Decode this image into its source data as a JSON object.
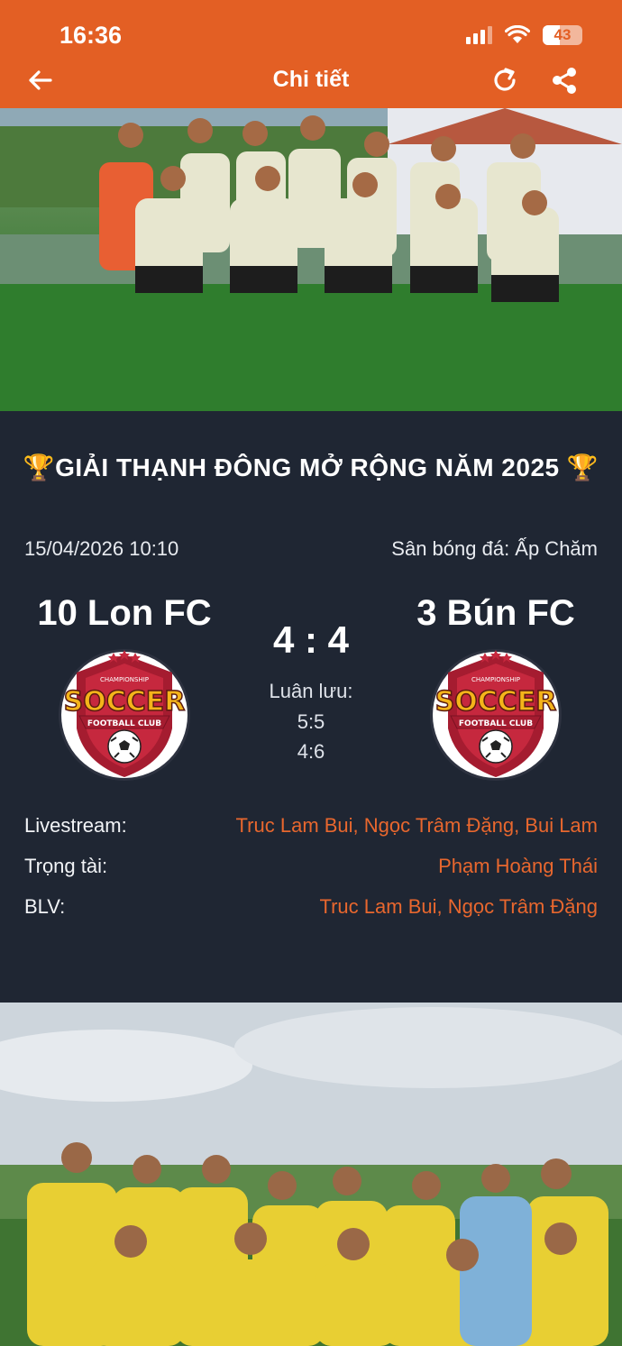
{
  "status_bar": {
    "time": "16:36",
    "battery": "43",
    "battery_level": 0.43
  },
  "header": {
    "title": "Chi tiết",
    "back_icon": "arrow-left-icon",
    "refresh_icon": "refresh-icon",
    "share_icon": "share-icon"
  },
  "colors": {
    "accent": "#e35f24",
    "background": "#1f2633",
    "link": "#e8672e"
  },
  "match": {
    "tournament": "🏆GIẢI THẠNH ĐÔNG MỞ RỘNG NĂM 2025 🏆",
    "datetime": "15/04/2026 10:10",
    "venue": "Sân bóng đá: Ấp Chăm",
    "home_team": "10 Lon FC",
    "away_team": "3 Bún FC",
    "score": "4 : 4",
    "penalty_label": "Luân lưu:",
    "penalty_scores": [
      "5:5",
      "4:6"
    ]
  },
  "info": {
    "livestream_label": "Livestream:",
    "livestream_value": "Truc Lam Bui, Ngọc Trâm Đặng, Bui Lam",
    "referee_label": "Trọng tài:",
    "referee_value": "Phạm Hoàng Thái",
    "commentator_label": "BLV:",
    "commentator_value": "Truc Lam Bui, Ngọc Trâm Đặng"
  },
  "logo": {
    "line1": "CHAMPIONSHIP",
    "line2": "SOCCER",
    "line3": "FOOTBALL CLUB"
  }
}
